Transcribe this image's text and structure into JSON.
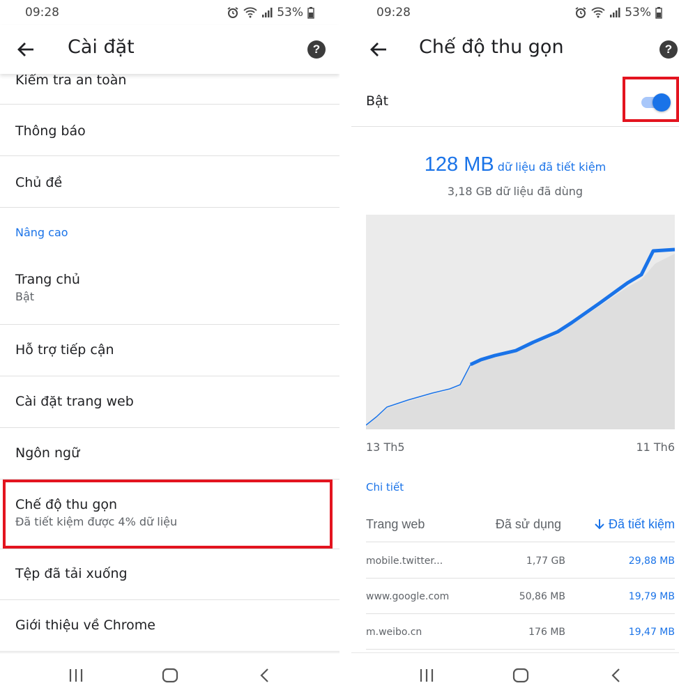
{
  "status": {
    "time": "09:28",
    "battery": "53%"
  },
  "left": {
    "title": "Cài đặt",
    "help": "?",
    "items": [
      {
        "label": "Kiểm tra an toàn"
      },
      {
        "label": "Thông báo"
      },
      {
        "label": "Chủ đề"
      },
      {
        "section": "Nâng cao"
      },
      {
        "label": "Trang chủ",
        "sub": "Bật"
      },
      {
        "label": "Hỗ trợ tiếp cận"
      },
      {
        "label": "Cài đặt trang web"
      },
      {
        "label": "Ngôn ngữ"
      },
      {
        "label": "Chế độ thu gọn",
        "sub": "Đã tiết kiệm được 4% dữ liệu"
      },
      {
        "label": "Tệp đã tải xuống"
      },
      {
        "label": "Giới thiệu về Chrome"
      }
    ]
  },
  "right": {
    "title": "Chế độ thu gọn",
    "help": "?",
    "toggle": {
      "label": "Bật",
      "state": "on"
    },
    "saved_amount": "128 MB",
    "saved_text": "dữ liệu đã tiết kiệm",
    "used_text": "3,18 GB dữ liệu đã dùng",
    "chart_start": "13 Th5",
    "chart_end": "11 Th6",
    "details_header": "Chi tiết",
    "table": {
      "col_site": "Trang web",
      "col_used": "Đã sử dụng",
      "col_saved": "Đã tiết kiệm",
      "sort_icon": "arrow-down-icon",
      "rows": [
        {
          "site": "mobile.twitter...",
          "used": "1,77 GB",
          "saved": "29,88 MB"
        },
        {
          "site": "www.google.com",
          "used": "50,86 MB",
          "saved": "19,79 MB"
        },
        {
          "site": "m.weibo.cn",
          "used": "176 MB",
          "saved": "19,47 MB"
        }
      ]
    }
  },
  "colors": {
    "accent": "#1a73e8",
    "highlight": "#e3141f",
    "chart_fill": "#e2e2e2"
  }
}
